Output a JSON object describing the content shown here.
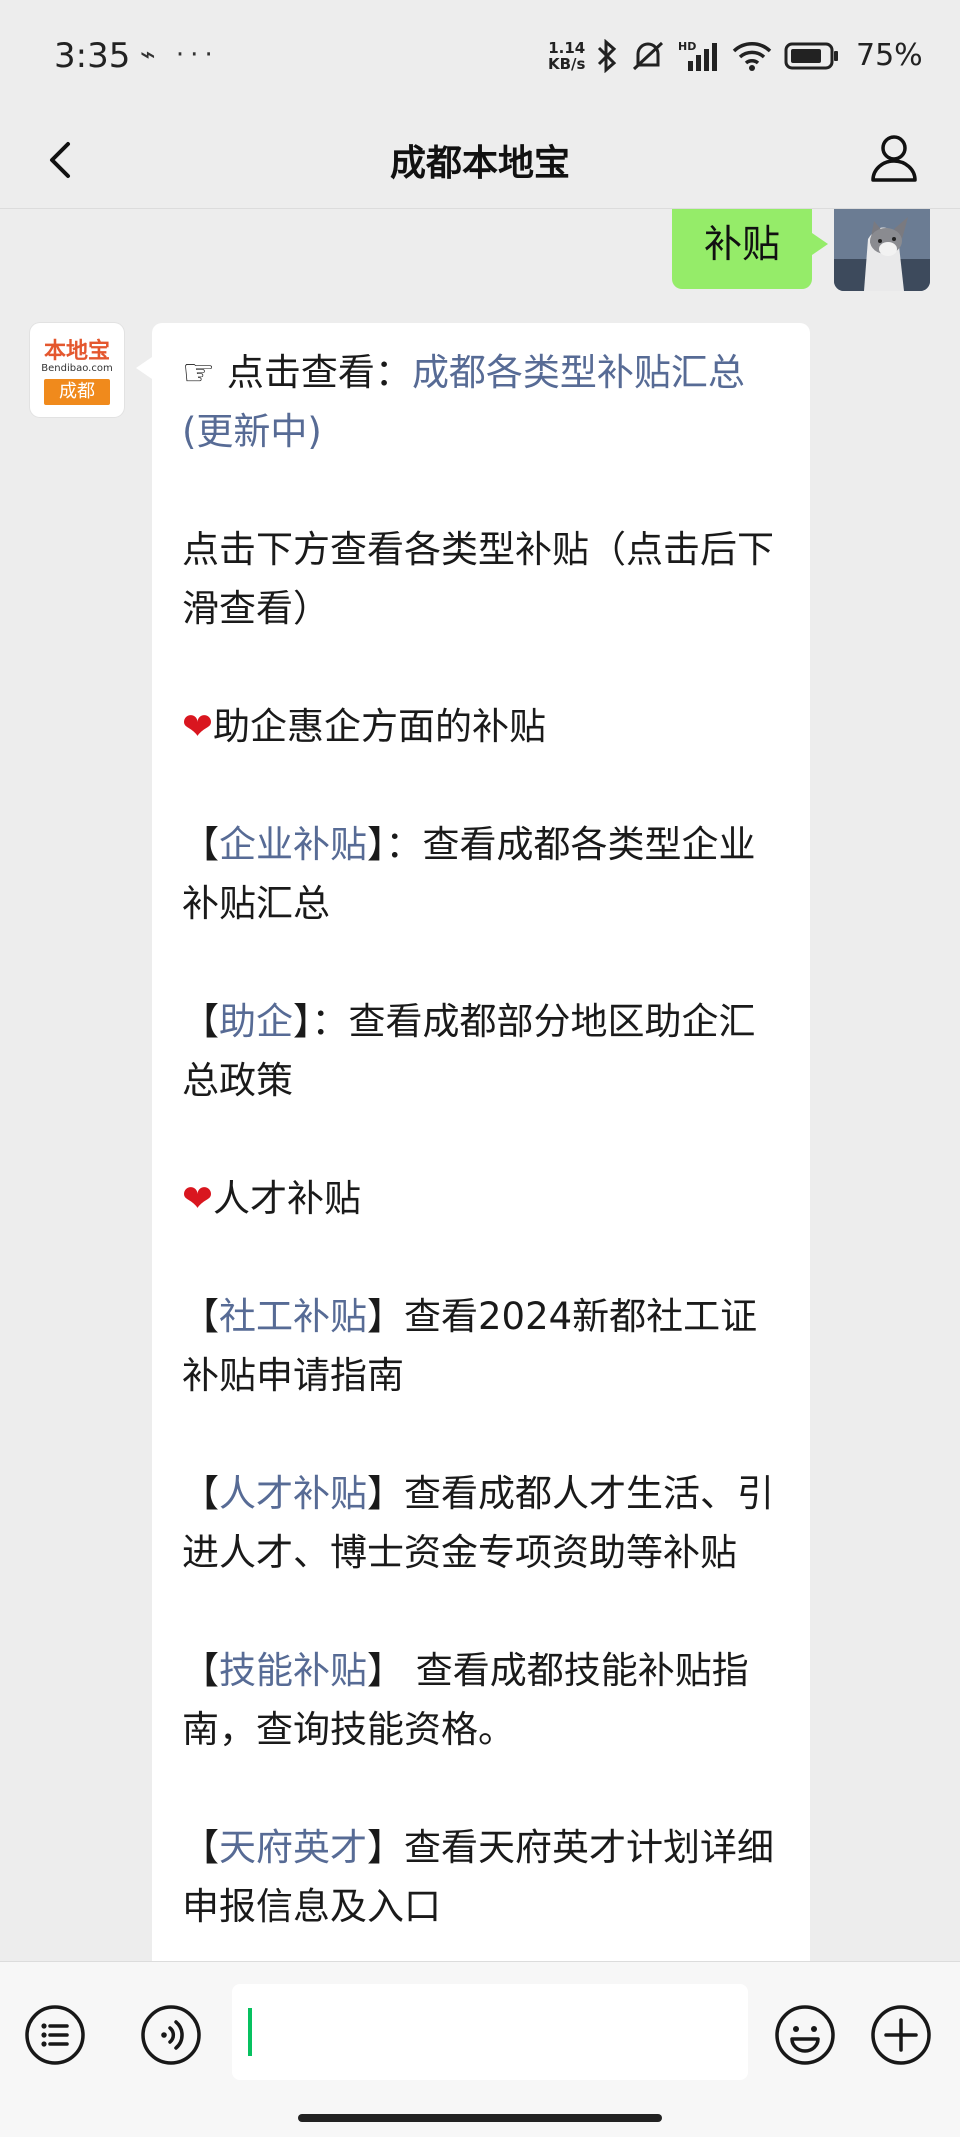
{
  "status_bar": {
    "time": "3:35",
    "left_icons": "⌁ ···",
    "net_speed_value": "1.14",
    "net_speed_unit": "KB/s",
    "battery": "75%"
  },
  "header": {
    "title": "成都本地宝"
  },
  "chat": {
    "outgoing": {
      "text": "补贴"
    },
    "bot_avatar": {
      "logo_text": "本地宝",
      "logo_sub": "Bendibao.com",
      "logo_city": "成都"
    },
    "reply": {
      "l1_prefix": "☞ 点击查看：",
      "l1_link": "成都各类型补贴汇总(更新中)",
      "l2": "点击下方查看各类型补贴（点击后下滑查看）",
      "heart": "❤",
      "l3": "助企惠企方面的补贴",
      "l4_bracket_open": "【",
      "l4_link": "企业补贴",
      "l4_rest": "】：查看成都各类型企业补贴汇总",
      "l5_bracket_open": "【",
      "l5_link": "助企",
      "l5_rest": "】：查看成都部分地区助企汇总政策",
      "l6": "人才补贴",
      "l7_bracket_open": "【",
      "l7_link": "社工补贴",
      "l7_rest": "】查看2024新都社工证补贴申请指南",
      "l8_bracket_open": "【",
      "l8_link": "人才补贴",
      "l8_rest": "】查看成都人才生活、引进人才、博士资金专项资助等补贴",
      "l9_bracket_open": "【",
      "l9_link": "技能补贴",
      "l9_rest": "】 查看成都技能补贴指南，查询技能资格。",
      "l10_bracket_open": "【",
      "l10_link": "天府英才",
      "l10_rest": "】查看天府英才计划详细申报信息及入口"
    }
  },
  "input_bar": {
    "value": ""
  },
  "colors": {
    "background": "#ededed",
    "outgoing_bubble": "#95ec69",
    "link": "#576b95",
    "heart": "#d9161f",
    "caret": "#07c160"
  }
}
